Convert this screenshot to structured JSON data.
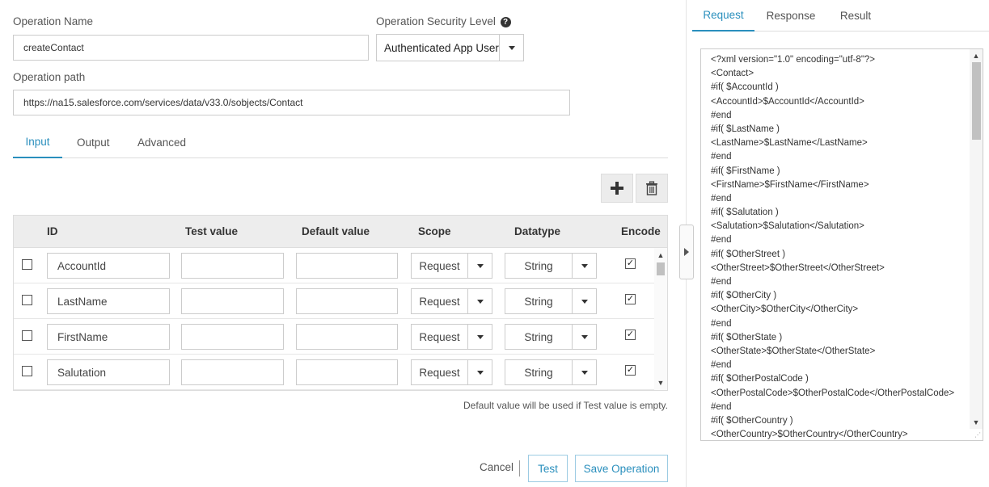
{
  "operation_name": {
    "label": "Operation Name",
    "value": "createContact"
  },
  "security_level": {
    "label": "Operation Security Level",
    "help_icon": "question-circle-icon",
    "value": "Authenticated App User"
  },
  "operation_path": {
    "label": "Operation path",
    "value": "https://na15.salesforce.com/services/data/v33.0/sobjects/Contact"
  },
  "tabs": [
    {
      "label": "Input",
      "active": true
    },
    {
      "label": "Output",
      "active": false
    },
    {
      "label": "Advanced",
      "active": false
    }
  ],
  "toolbar": {
    "add_icon": "plus-icon",
    "delete_icon": "trash-icon"
  },
  "grid": {
    "headers": {
      "id": "ID",
      "test_value": "Test value",
      "default_value": "Default value",
      "scope": "Scope",
      "datatype": "Datatype",
      "encode": "Encode"
    },
    "rows": [
      {
        "id": "AccountId",
        "test_value": "",
        "default_value": "",
        "scope": "Request",
        "datatype": "String",
        "encode": true,
        "selected": false
      },
      {
        "id": "LastName",
        "test_value": "",
        "default_value": "",
        "scope": "Request",
        "datatype": "String",
        "encode": true,
        "selected": false
      },
      {
        "id": "FirstName",
        "test_value": "",
        "default_value": "",
        "scope": "Request",
        "datatype": "String",
        "encode": true,
        "selected": false
      },
      {
        "id": "Salutation",
        "test_value": "",
        "default_value": "",
        "scope": "Request",
        "datatype": "String",
        "encode": true,
        "selected": false
      }
    ]
  },
  "hint": "Default value will be used if Test value is empty.",
  "actions": {
    "cancel": "Cancel",
    "test": "Test",
    "save": "Save Operation"
  },
  "right_tabs": [
    {
      "label": "Request",
      "active": true
    },
    {
      "label": "Response",
      "active": false
    },
    {
      "label": "Result",
      "active": false
    }
  ],
  "request_body": [
    "<?xml version=\"1.0\" encoding=\"utf-8\"?>",
    "<Contact>",
    "#if( $AccountId )",
    "<AccountId>$AccountId</AccountId>",
    "#end",
    "#if( $LastName )",
    "<LastName>$LastName</LastName>",
    "#end",
    "#if( $FirstName )",
    "<FirstName>$FirstName</FirstName>",
    "#end",
    "#if( $Salutation )",
    "<Salutation>$Salutation</Salutation>",
    "#end",
    "#if( $OtherStreet )",
    "<OtherStreet>$OtherStreet</OtherStreet>",
    "#end",
    "#if( $OtherCity )",
    "<OtherCity>$OtherCity</OtherCity>",
    "#end",
    "#if( $OtherState )",
    "<OtherState>$OtherState</OtherState>",
    "#end",
    "#if( $OtherPostalCode )",
    "<OtherPostalCode>$OtherPostalCode</OtherPostalCode>",
    "#end",
    "#if( $OtherCountry )",
    "<OtherCountry>$OtherCountry</OtherCountry>"
  ],
  "colors": {
    "accent": "#2a8fbd",
    "border": "#cccccc",
    "header_bg": "#ededed"
  }
}
